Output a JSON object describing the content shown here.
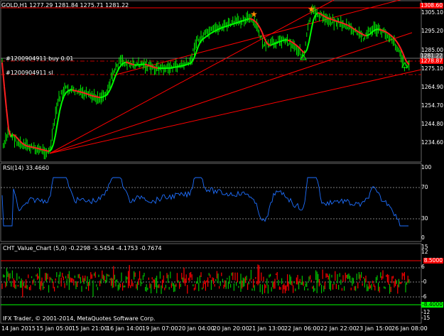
{
  "main": {
    "header": "GOLD,H1  1277.29 1281.84 1275.71 1281.22",
    "order_buy": "#1200904911 buy  0.01",
    "order_sl": "#1200904911 sl",
    "price_ticks": [
      "1305.10",
      "1295.20",
      "1285.00",
      "1275.10",
      "1264.90",
      "1254.70",
      "1244.80",
      "1234.60"
    ],
    "price_tags": {
      "high": "1308.60",
      "current": "1281.22",
      "marker": "1278.87"
    }
  },
  "rsi": {
    "header": "RSI(14) 33.4660",
    "ticks": [
      "100",
      "70",
      "30",
      "0"
    ]
  },
  "cht": {
    "header": "CHT_Value_Chart (5,0) -0.2298 -5.5454 -4.1753 -0.7674",
    "ticks": [
      "15",
      "12",
      "8",
      "6",
      "-0",
      "-6",
      "-8",
      "-12",
      "-15"
    ],
    "tags": {
      "upper": "8.5000",
      "lower": "-8.4000"
    }
  },
  "footer": {
    "copyright": "IFX Trader, © 2001-2014, MetaQuotes Software Corp."
  },
  "time_axis": [
    "14 Jan 2015",
    "15 Jan 05:00",
    "15 Jan 21:00",
    "16 Jan 14:00",
    "19 Jan 07:00",
    "20 Jan 04:00",
    "20 Jan 20:00",
    "21 Jan 13:00",
    "22 Jan 06:00",
    "22 Jan 22:00",
    "23 Jan 15:00",
    "26 Jan 08:00"
  ],
  "colors": {
    "bg": "#000000",
    "candle": "#00ff00",
    "ma_up": "#00ff00",
    "ma_down": "#ff2020",
    "trend": "#ff0000",
    "rsi": "#1e6fff",
    "grid": "#ffffff",
    "bar_up": "#00c000",
    "bar_down": "#ff0000"
  }
}
